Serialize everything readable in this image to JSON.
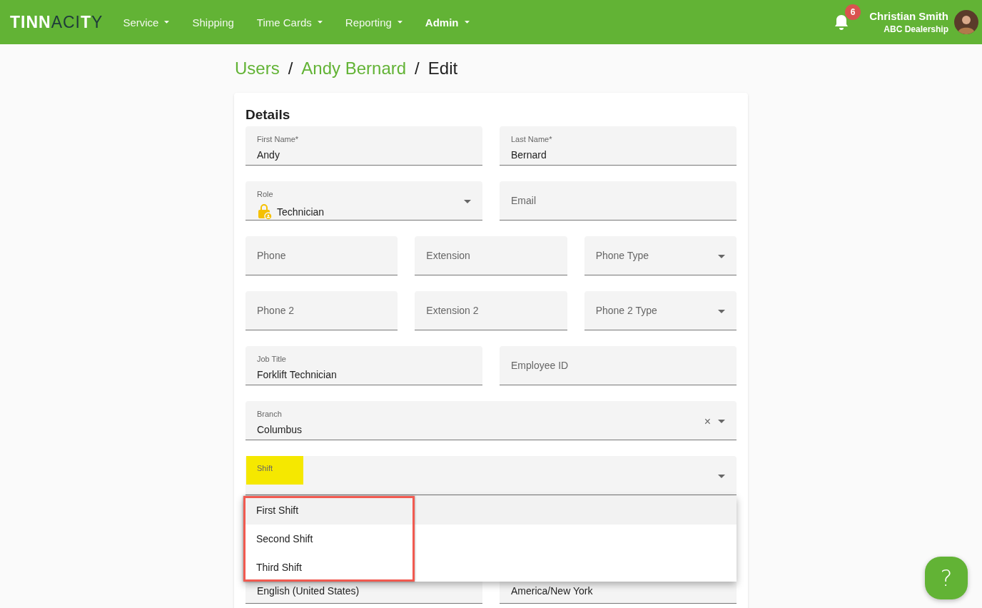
{
  "logo": [
    {
      "text": "TINN",
      "kind": "strong"
    },
    {
      "text": "ACI",
      "kind": "light"
    },
    {
      "text": "T",
      "kind": "strong"
    },
    {
      "text": "Y",
      "kind": "light"
    }
  ],
  "nav": [
    {
      "label": "Service",
      "dropdown": true,
      "selected": false
    },
    {
      "label": "Shipping",
      "dropdown": false,
      "selected": false
    },
    {
      "label": "Time Cards",
      "dropdown": true,
      "selected": false
    },
    {
      "label": "Reporting",
      "dropdown": true,
      "selected": false
    },
    {
      "label": "Admin",
      "dropdown": true,
      "selected": true
    }
  ],
  "notifications": {
    "count": "6"
  },
  "user": {
    "name": "Christian Smith",
    "company": "ABC Dealership"
  },
  "breadcrumb": [
    {
      "label": "Users",
      "link": true
    },
    {
      "label": "Andy Bernard",
      "link": true
    },
    {
      "label": "Edit",
      "link": false
    }
  ],
  "separator": "/",
  "card": {
    "title": "Details",
    "rows": [
      [
        {
          "label": "First Name*",
          "value": "Andy",
          "kind": "text"
        },
        {
          "label": "Last Name*",
          "value": "Bernard",
          "kind": "text"
        }
      ],
      [
        {
          "label": "Role",
          "value": "Technician",
          "kind": "role-select"
        },
        {
          "label": "Email",
          "kind": "text"
        }
      ],
      [
        {
          "label": "Phone",
          "kind": "text"
        },
        {
          "label": "Extension",
          "kind": "text"
        },
        {
          "label": "Phone Type",
          "kind": "select"
        }
      ],
      [
        {
          "label": "Phone 2",
          "kind": "text"
        },
        {
          "label": "Extension 2",
          "kind": "text"
        },
        {
          "label": "Phone 2 Type",
          "kind": "select"
        }
      ],
      [
        {
          "label": "Job Title",
          "value": "Forklift Technician",
          "kind": "text"
        },
        {
          "label": "Employee ID",
          "kind": "text"
        }
      ],
      [
        {
          "label": "Branch",
          "value": "Columbus",
          "kind": "select",
          "clearable": true
        }
      ],
      [
        {
          "label": "Shift",
          "kind": "select",
          "label_highlighted": true,
          "open": true
        }
      ],
      [
        {
          "value": "English (United States)",
          "kind": "text"
        },
        {
          "value": "America/New York",
          "kind": "text"
        }
      ]
    ]
  },
  "menu": {
    "clear_symbol": "×",
    "items": [
      {
        "label": "First Shift",
        "highlighted": true
      },
      {
        "label": "Second Shift",
        "highlighted": false
      },
      {
        "label": "Third Shift",
        "highlighted": false
      }
    ]
  },
  "help": {
    "symbol": "?"
  }
}
